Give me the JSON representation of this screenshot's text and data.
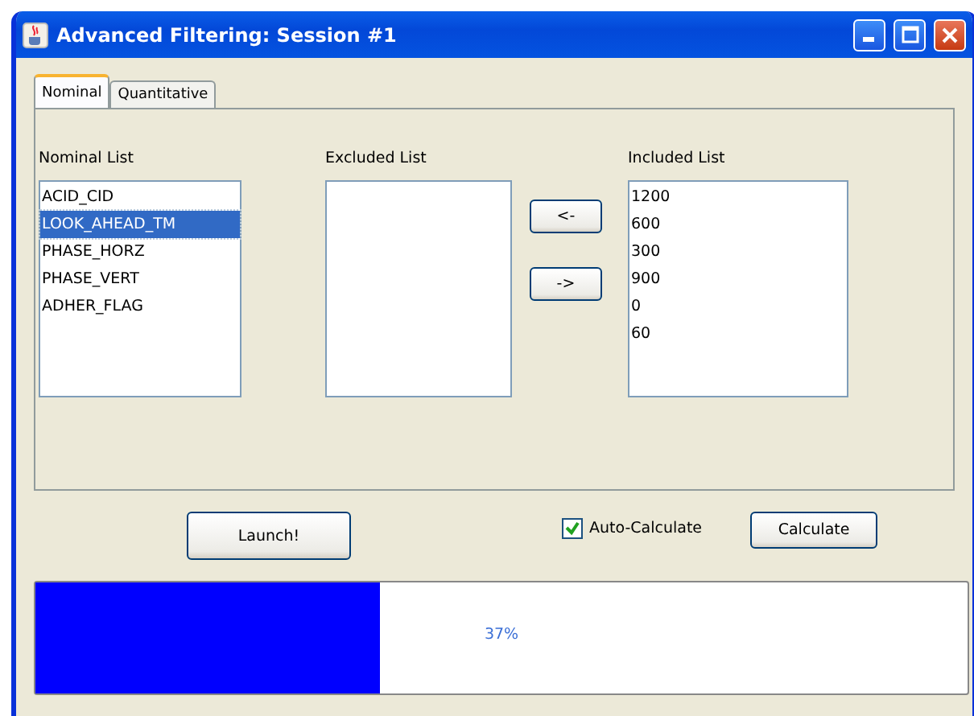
{
  "window": {
    "title": "Advanced Filtering: Session #1"
  },
  "tabs": [
    {
      "label": "Nominal",
      "selected": true
    },
    {
      "label": "Quantitative",
      "selected": false
    }
  ],
  "lists": [
    {
      "label": "Nominal List",
      "items": [
        {
          "text": "ACID_CID",
          "selected": false
        },
        {
          "text": "LOOK_AHEAD_TM",
          "selected": true
        },
        {
          "text": "PHASE_HORZ",
          "selected": false
        },
        {
          "text": "PHASE_VERT",
          "selected": false
        },
        {
          "text": "ADHER_FLAG",
          "selected": false
        }
      ]
    },
    {
      "label": "Excluded List"
    },
    {
      "label": "Included List",
      "items": [
        {
          "text": "1200",
          "selected": false
        },
        {
          "text": "600",
          "selected": false
        },
        {
          "text": "300",
          "selected": false
        },
        {
          "text": "900",
          "selected": false
        },
        {
          "text": "0",
          "selected": false
        },
        {
          "text": "60",
          "selected": false
        }
      ]
    }
  ],
  "move_buttons": [
    "<-",
    "->"
  ],
  "launch_button": "Launch!",
  "auto_calculate": {
    "label": "Auto-Calculate",
    "checked": true
  },
  "calculate_button": "Calculate",
  "progress": {
    "level": 0.37,
    "reading": "37%"
  }
}
